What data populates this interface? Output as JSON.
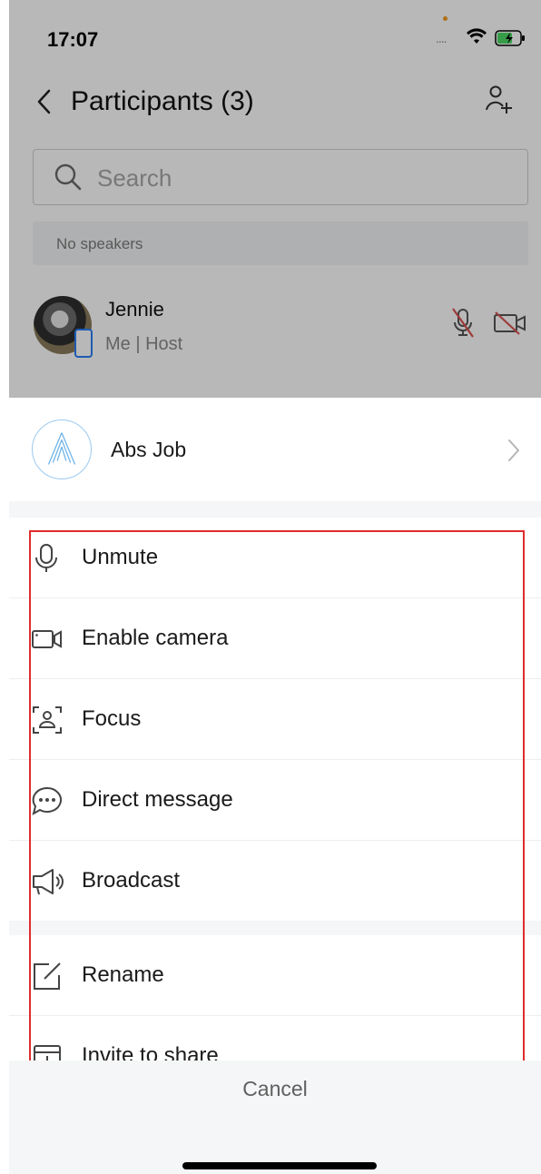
{
  "status": {
    "time": "17:07"
  },
  "nav": {
    "title": "Participants (3)"
  },
  "search": {
    "placeholder": "Search"
  },
  "speakers": {
    "text": "No speakers"
  },
  "participant": {
    "name": "Jennie",
    "role": "Me | Host"
  },
  "sheet": {
    "name": "Abs Job",
    "items": [
      {
        "label": "Unmute",
        "icon": "microphone-icon"
      },
      {
        "label": "Enable camera",
        "icon": "camera-icon"
      },
      {
        "label": "Focus",
        "icon": "focus-icon"
      },
      {
        "label": "Direct message",
        "icon": "chat-bubble-icon"
      },
      {
        "label": "Broadcast",
        "icon": "megaphone-icon"
      },
      {
        "label": "Rename",
        "icon": "edit-icon"
      },
      {
        "label": "Invite to share",
        "icon": "share-screen-icon"
      }
    ],
    "cancel": "Cancel"
  },
  "colors": {
    "accent": "#2a7ef5",
    "highlight": "#e02c2c",
    "muted_red": "#d9534f"
  }
}
